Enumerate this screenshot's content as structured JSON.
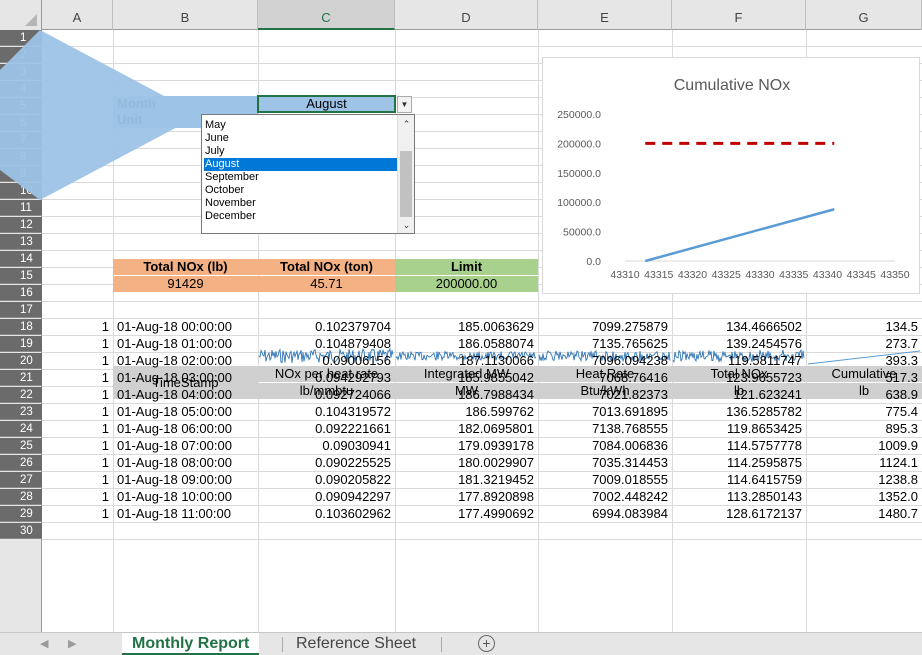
{
  "colors": {
    "accent": "#217346",
    "label_blue": "#9dc3e6",
    "orange": "#f4b183",
    "green": "#a9d18e",
    "header_gray": "#d0d0d0",
    "selection_blue": "#0078d7",
    "callout_blue": "#9dc3e6"
  },
  "columns": [
    "A",
    "B",
    "C",
    "D",
    "E",
    "F",
    "G"
  ],
  "selected_column": "C",
  "rows": [
    "1",
    "2",
    "3",
    "4",
    "5",
    "6",
    "7",
    "8",
    "9",
    "10",
    "11",
    "12",
    "13",
    "14",
    "15",
    "16",
    "17",
    "18",
    "19",
    "20",
    "21",
    "22",
    "23",
    "24",
    "25",
    "26",
    "27",
    "28",
    "29",
    "30"
  ],
  "controls": {
    "month_label": "Month",
    "unit_label": "Unit",
    "month_value": "August",
    "dropdown_icon": "chevron-down-icon",
    "options": [
      "May",
      "June",
      "July",
      "August",
      "September",
      "October",
      "November",
      "December"
    ],
    "selected_option": "August"
  },
  "summary": {
    "total_lb_label": "Total NOx (lb)",
    "total_lb_value": "91429",
    "total_ton_label": "Total NOx (ton)",
    "total_ton_value": "45.71",
    "limit_label": "Limit",
    "limit_value": "200000.00"
  },
  "table": {
    "headers": [
      {
        "line1": "TimeStamp",
        "line2": ""
      },
      {
        "line1": "NOx per heat rate",
        "line2": "lb/mmbtu"
      },
      {
        "line1": "Integrated MW",
        "line2": "MW"
      },
      {
        "line1": "Heat Rate",
        "line2": "Btu/kWh"
      },
      {
        "line1": "Total NOx",
        "line2": "lb"
      },
      {
        "line1": "Cumulative",
        "line2": "lb"
      }
    ],
    "rows": [
      [
        "1",
        "01-Aug-18 00:00:00",
        "0.102379704",
        "185.0063629",
        "7099.275879",
        "134.4666502",
        "134.5"
      ],
      [
        "1",
        "01-Aug-18 01:00:00",
        "0.104879408",
        "186.0588074",
        "7135.765625",
        "139.2454576",
        "273.7"
      ],
      [
        "1",
        "01-Aug-18 02:00:00",
        "0.09006156",
        "187.1130066",
        "7096.094238",
        "119.5811747",
        "393.3"
      ],
      [
        "1",
        "01-Aug-18 03:00:00",
        "0.094292793",
        "185.9855042",
        "7068.76416",
        "123.9655723",
        "517.3"
      ],
      [
        "1",
        "01-Aug-18 04:00:00",
        "0.092724066",
        "186.7988434",
        "7021.82373",
        "121.623241",
        "638.9"
      ],
      [
        "1",
        "01-Aug-18 05:00:00",
        "0.104319572",
        "186.599762",
        "7013.691895",
        "136.5285782",
        "775.4"
      ],
      [
        "1",
        "01-Aug-18 06:00:00",
        "0.092221661",
        "182.0695801",
        "7138.768555",
        "119.8653425",
        "895.3"
      ],
      [
        "1",
        "01-Aug-18 07:00:00",
        "0.09030941",
        "179.0939178",
        "7084.006836",
        "114.5757778",
        "1009.9"
      ],
      [
        "1",
        "01-Aug-18 08:00:00",
        "0.090225525",
        "180.0029907",
        "7035.314453",
        "114.2595875",
        "1124.1"
      ],
      [
        "1",
        "01-Aug-18 09:00:00",
        "0.090205822",
        "181.3219452",
        "7009.018555",
        "114.6415759",
        "1238.8"
      ],
      [
        "1",
        "01-Aug-18 10:00:00",
        "0.090942297",
        "177.8920898",
        "7002.448242",
        "113.2850143",
        "1352.0"
      ],
      [
        "1",
        "01-Aug-18 11:00:00",
        "0.103602962",
        "177.4990692",
        "6994.083984",
        "128.6172137",
        "1480.7"
      ]
    ]
  },
  "chart_data": {
    "type": "line",
    "title": "Cumulative NOx",
    "xlim": [
      43310,
      43350
    ],
    "ylim": [
      0,
      250000
    ],
    "x_ticks": [
      "43310",
      "43315",
      "43320",
      "43325",
      "43330",
      "43335",
      "43340",
      "43345",
      "43350"
    ],
    "y_ticks": [
      "0.0",
      "50000.0",
      "100000.0",
      "150000.0",
      "200000.0",
      "250000.0"
    ],
    "series": [
      {
        "style": "solid",
        "color": "#5b9bd5",
        "x": [
          43313,
          43341
        ],
        "y": [
          0,
          88000
        ]
      },
      {
        "style": "dashed",
        "color": "#c00000",
        "x": [
          43313,
          43341
        ],
        "y": [
          200000,
          200000
        ]
      }
    ],
    "grid": false,
    "legend": "none"
  },
  "tabs": {
    "active": "Monthly Report",
    "other": "Reference Sheet",
    "add": "+"
  }
}
